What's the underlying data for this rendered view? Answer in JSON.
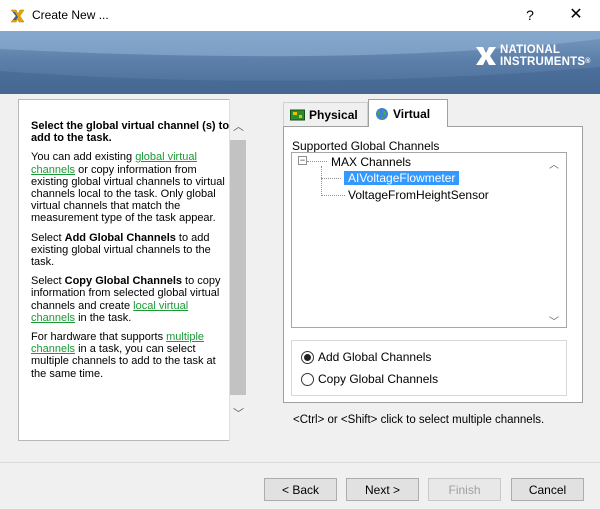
{
  "window": {
    "title": "Create New ...",
    "help_glyph": "?",
    "close_glyph": "✕"
  },
  "banner": {
    "brand_line1": "NATIONAL",
    "brand_line2": "INSTRUMENTS",
    "trademark": "®"
  },
  "help": {
    "heading": "Select the global virtual channel (s) to add to the task.",
    "p1_before": "You can add existing ",
    "p1_link": "global virtual channels",
    "p1_after": " or copy information from existing global virtual channels to virtual channels local to the task. Only global virtual channels that match the measurement type of the task appear.",
    "p2_before": "Select ",
    "p2_bold": "Add Global Channels",
    "p2_after": " to add existing global virtual channels to the task.",
    "p3_before": "Select ",
    "p3_bold": "Copy Global Channels",
    "p3_mid": " to copy information from selected global virtual channels and create ",
    "p3_link": "local virtual channels",
    "p3_after": " in the task.",
    "p4_before": "For hardware that supports ",
    "p4_link": "multiple channels",
    "p4_after": " in a task, you can select multiple channels to add to the task at the same time.",
    "scroll_up_glyph": "︿",
    "scroll_down_glyph": "﹀"
  },
  "tabs": [
    {
      "label": "Physical",
      "icon": "physical-board-icon"
    },
    {
      "label": "Virtual",
      "icon": "virtual-globe-icon"
    }
  ],
  "channels": {
    "group_label": "Supported Global Channels",
    "root": "MAX Channels",
    "items": [
      "AIVoltageFlowmeter",
      "VoltageFromHeightSensor"
    ],
    "selected_index": 0,
    "expander_glyph": "−",
    "scroll_up_glyph": "︿",
    "scroll_down_glyph": "﹀"
  },
  "options": {
    "add_label": "Add Global Channels",
    "copy_label": "Copy Global Channels",
    "selected": "add"
  },
  "hint": "<Ctrl> or <Shift> click to select multiple channels.",
  "buttons": {
    "back": "< Back",
    "next": "Next >",
    "finish": "Finish",
    "cancel": "Cancel"
  },
  "colors": {
    "accent_link": "#1a9a35",
    "selection": "#3399ff",
    "banner": "#5d80ab"
  }
}
